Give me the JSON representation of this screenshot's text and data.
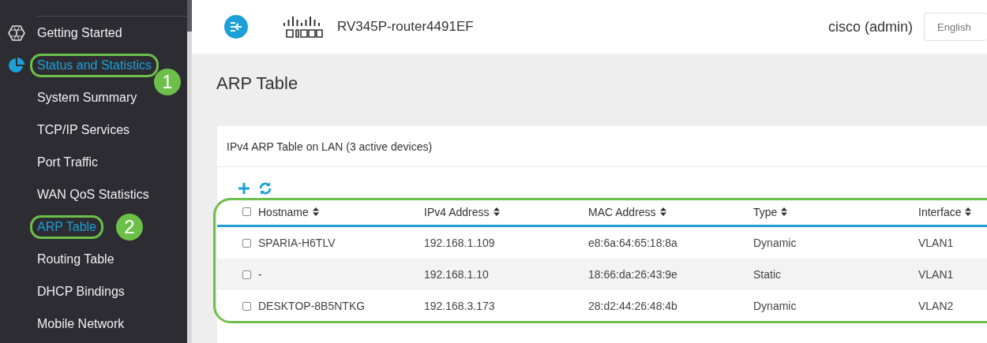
{
  "sidebar": {
    "items": [
      {
        "label": "Getting Started",
        "kind": "section",
        "selected": false
      },
      {
        "label": "Status and Statistics",
        "kind": "section",
        "selected": true,
        "callout": "1"
      },
      {
        "label": "System Summary",
        "kind": "page",
        "selected": false
      },
      {
        "label": "TCP/IP Services",
        "kind": "page",
        "selected": false
      },
      {
        "label": "Port Traffic",
        "kind": "page",
        "selected": false
      },
      {
        "label": "WAN QoS Statistics",
        "kind": "page",
        "selected": false
      },
      {
        "label": "ARP Table",
        "kind": "page",
        "selected": true,
        "callout": "2"
      },
      {
        "label": "Routing Table",
        "kind": "page",
        "selected": false
      },
      {
        "label": "DHCP Bindings",
        "kind": "page",
        "selected": false
      },
      {
        "label": "Mobile Network",
        "kind": "page",
        "selected": false
      }
    ]
  },
  "header": {
    "device": "RV345P-router4491EF",
    "user": "cisco (admin)",
    "language": "English"
  },
  "page_title": "ARP Table",
  "card": {
    "title": "IPv4 ARP Table on LAN (3 active devices)",
    "table": {
      "select_all": {
        "checked": false
      },
      "columns": [
        "Hostname",
        "IPv4 Address",
        "MAC Address",
        "Type",
        "Interface"
      ],
      "rows": [
        {
          "checked": false,
          "cells": [
            "SPARIA-H6TLV",
            "192.168.1.109",
            "e8:6a:64:65:18:8a",
            "Dynamic",
            "VLAN1"
          ]
        },
        {
          "checked": false,
          "cells": [
            "-",
            "192.168.1.10",
            "18:66:da:26:43:9e",
            "Static",
            "VLAN1"
          ]
        },
        {
          "checked": false,
          "cells": [
            "DESKTOP-8B5NTKG",
            "192.168.3.173",
            "28:d2:44:26:48:4b",
            "Dynamic",
            "VLAN2"
          ]
        }
      ]
    }
  }
}
